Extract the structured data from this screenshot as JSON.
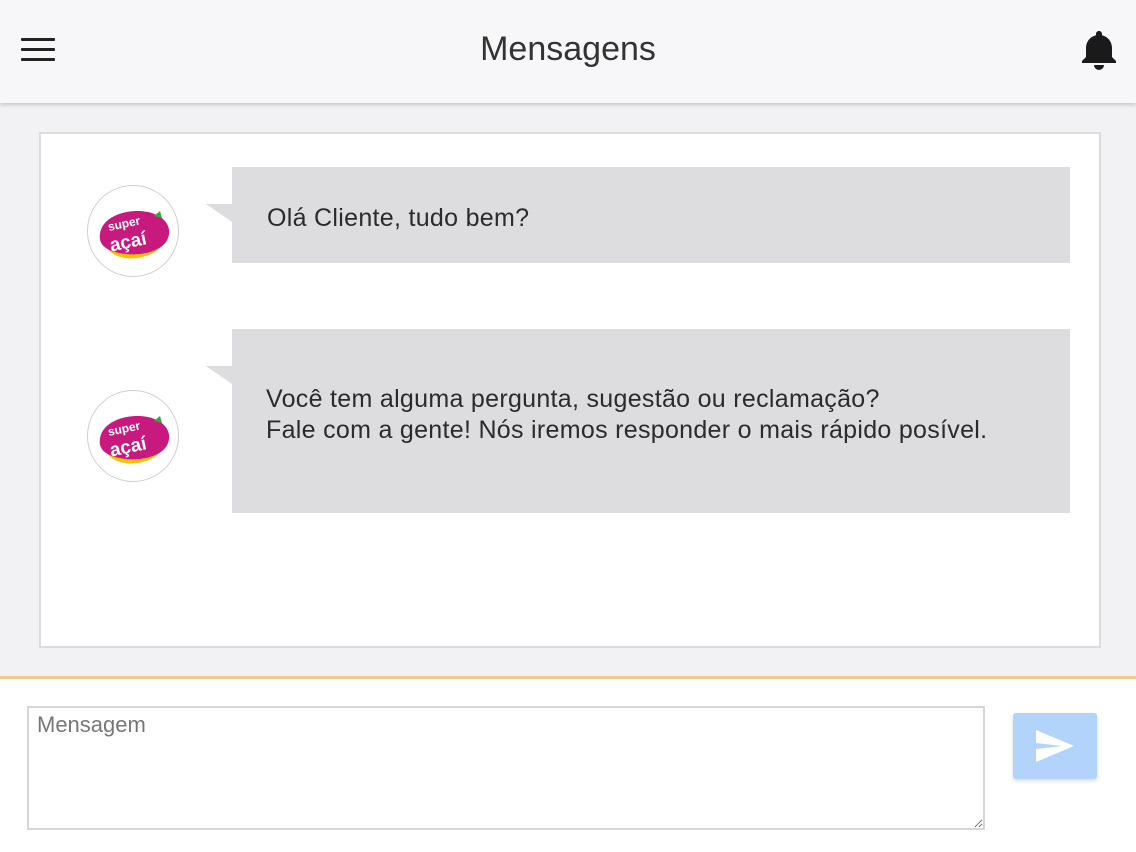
{
  "header": {
    "title": "Mensagens",
    "menu_icon": "hamburger-menu-icon",
    "notifications_icon": "bell-icon"
  },
  "chat": {
    "messages": [
      {
        "sender_logo_text": [
          "super",
          "açaí"
        ],
        "lines": [
          "Olá Cliente, tudo bem?"
        ]
      },
      {
        "sender_logo_text": [
          "super",
          "açaí"
        ],
        "lines": [
          "Você tem alguma pergunta, sugestão ou reclamação?",
          "Fale com a gente! Nós iremos responder o mais rápido posível."
        ]
      }
    ]
  },
  "composer": {
    "placeholder": "Mensagem",
    "value": "",
    "send_icon": "send-icon"
  },
  "colors": {
    "bubble": "#dddcdf",
    "footer_accent": "#f5c98a",
    "send_button": "#b3d4fa",
    "logo_magenta": "#c8197e",
    "logo_yellow": "#f6c400"
  }
}
